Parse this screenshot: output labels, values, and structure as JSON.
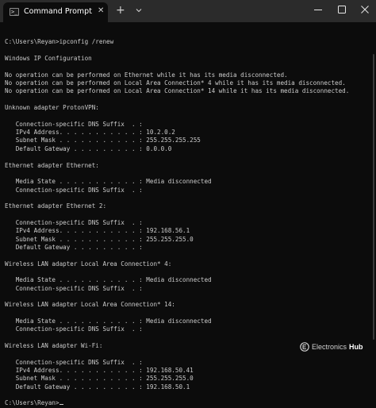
{
  "window": {
    "tab_title": "Command Prompt",
    "tab_close": "✕",
    "new_tab": "+",
    "icons": {
      "tab": "cmd-icon",
      "dropdown": "chevron-down-icon",
      "minimize": "minimize-icon",
      "maximize": "maximize-icon",
      "close": "close-icon"
    },
    "colors": {
      "titlebar": "#2b2b2b",
      "background": "#0c0c0c",
      "text": "#cccccc"
    }
  },
  "terminal": {
    "lines": [
      "",
      "C:\\Users\\Reyan>ipconfig /renew",
      "",
      "Windows IP Configuration",
      "",
      "No operation can be performed on Ethernet while it has its media disconnected.",
      "No operation can be performed on Local Area Connection* 4 while it has its media disconnected.",
      "No operation can be performed on Local Area Connection* 14 while it has its media disconnected.",
      "",
      "Unknown adapter ProtonVPN:",
      "",
      "   Connection-specific DNS Suffix  . :",
      "   IPv4 Address. . . . . . . . . . . : 10.2.0.2",
      "   Subnet Mask . . . . . . . . . . . : 255.255.255.255",
      "   Default Gateway . . . . . . . . . : 0.0.0.0",
      "",
      "Ethernet adapter Ethernet:",
      "",
      "   Media State . . . . . . . . . . . : Media disconnected",
      "   Connection-specific DNS Suffix  . :",
      "",
      "Ethernet adapter Ethernet 2:",
      "",
      "   Connection-specific DNS Suffix  . :",
      "   IPv4 Address. . . . . . . . . . . : 192.168.56.1",
      "   Subnet Mask . . . . . . . . . . . : 255.255.255.0",
      "   Default Gateway . . . . . . . . . :",
      "",
      "Wireless LAN adapter Local Area Connection* 4:",
      "",
      "   Media State . . . . . . . . . . . : Media disconnected",
      "   Connection-specific DNS Suffix  . :",
      "",
      "Wireless LAN adapter Local Area Connection* 14:",
      "",
      "   Media State . . . . . . . . . . . : Media disconnected",
      "   Connection-specific DNS Suffix  . :",
      "",
      "Wireless LAN adapter Wi-Fi:",
      "",
      "   Connection-specific DNS Suffix  . :",
      "   IPv4 Address. . . . . . . . . . . : 192.168.50.41",
      "   Subnet Mask . . . . . . . . . . . : 255.255.255.0",
      "   Default Gateway . . . . . . . . . : 192.168.50.1",
      "",
      "C:\\Users\\Reyan>"
    ]
  },
  "watermark": {
    "brand_a": "Electronics",
    "brand_b": "Hub"
  }
}
